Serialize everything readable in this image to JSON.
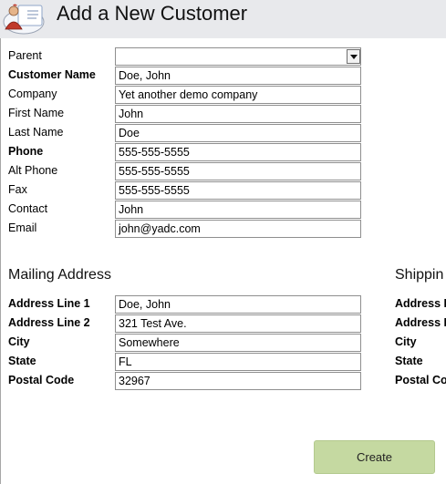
{
  "header": {
    "title": "Add a New Customer",
    "icon": "customer-card-icon"
  },
  "customer": {
    "parent_label": "Parent",
    "parent_value": "",
    "customer_name_label": "Customer Name",
    "customer_name_value": "Doe, John",
    "company_label": "Company",
    "company_value": "Yet another demo company",
    "first_name_label": "First Name",
    "first_name_value": "John",
    "last_name_label": "Last Name",
    "last_name_value": "Doe",
    "phone_label": "Phone",
    "phone_value": "555-555-5555",
    "alt_phone_label": "Alt Phone",
    "alt_phone_value": "555-555-5555",
    "fax_label": "Fax",
    "fax_value": "555-555-5555",
    "contact_label": "Contact",
    "contact_value": "John",
    "email_label": "Email",
    "email_value": "john@yadc.com"
  },
  "mailing": {
    "title": "Mailing Address",
    "address1_label": "Address Line 1",
    "address1_value": "Doe, John",
    "address2_label": "Address Line 2",
    "address2_value": "321 Test Ave.",
    "city_label": "City",
    "city_value": "Somewhere",
    "state_label": "State",
    "state_value": "FL",
    "postal_label": "Postal Code",
    "postal_value": "32967"
  },
  "shipping": {
    "title": "Shippin",
    "address1_label": "Address L",
    "address2_label": "Address L",
    "city_label": "City",
    "state_label": "State",
    "postal_label": "Postal Co"
  },
  "actions": {
    "create_label": "Create"
  },
  "colors": {
    "header_bg": "#e8e9ec",
    "create_bg": "#c5d9a1"
  }
}
